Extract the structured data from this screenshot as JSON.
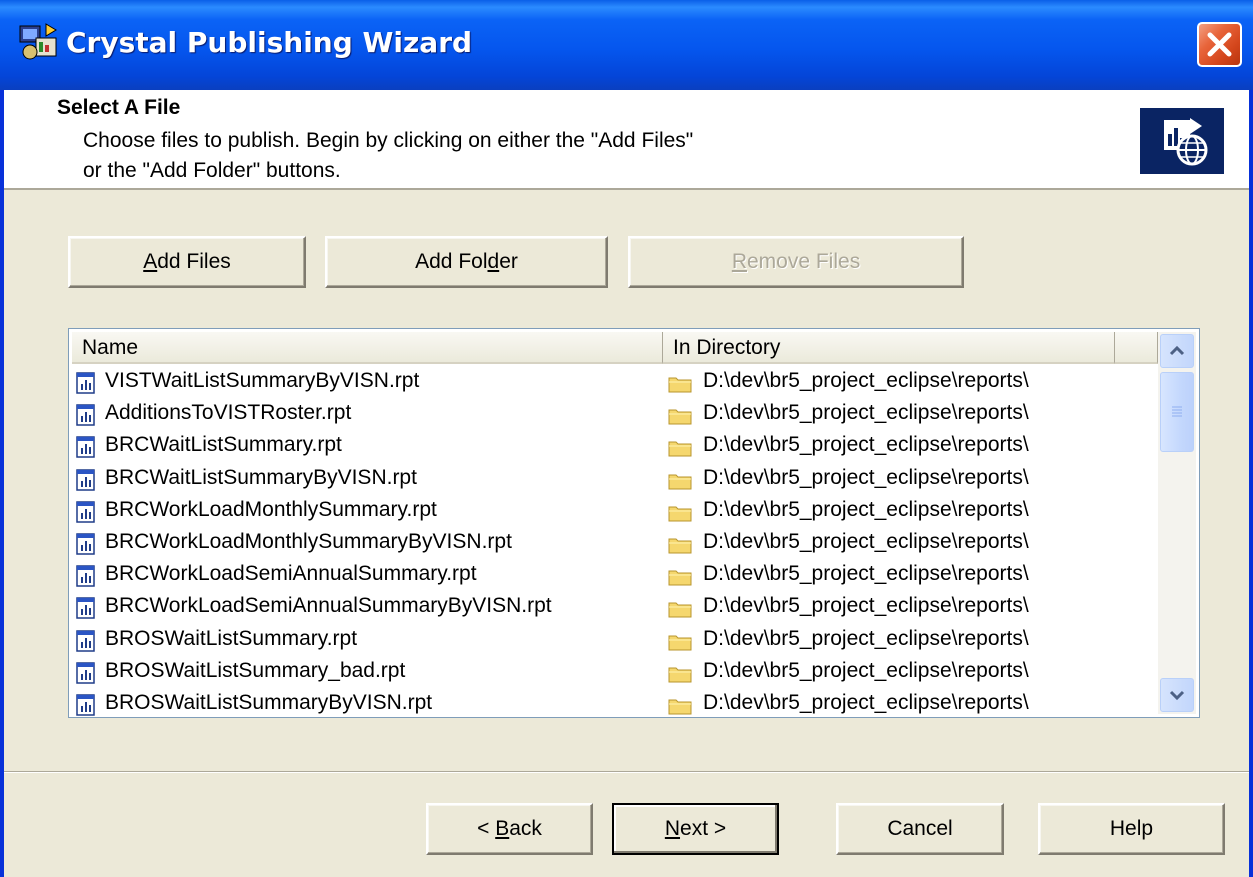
{
  "window": {
    "title": "Crystal Publishing Wizard"
  },
  "header": {
    "step_title": "Select A File",
    "description_line1": "Choose files to publish.  Begin by clicking on either the \"Add Files\"",
    "description_line2": "or the \"Add Folder\" buttons."
  },
  "toolbar": {
    "add_files": {
      "pre": "",
      "key": "A",
      "post": "dd Files"
    },
    "add_folder": {
      "pre": "Add Fol",
      "key": "d",
      "post": "er"
    },
    "remove_files": {
      "pre": "",
      "key": "R",
      "post": "emove Files",
      "disabled": true
    }
  },
  "list": {
    "columns": [
      "Name",
      "In Directory"
    ],
    "rows": [
      {
        "name": "VISTWaitListSummaryByVISN.rpt",
        "dir": "D:\\dev\\br5_project_eclipse\\reports\\"
      },
      {
        "name": "AdditionsToVISTRoster.rpt",
        "dir": "D:\\dev\\br5_project_eclipse\\reports\\"
      },
      {
        "name": "BRCWaitListSummary.rpt",
        "dir": "D:\\dev\\br5_project_eclipse\\reports\\"
      },
      {
        "name": "BRCWaitListSummaryByVISN.rpt",
        "dir": "D:\\dev\\br5_project_eclipse\\reports\\"
      },
      {
        "name": "BRCWorkLoadMonthlySummary.rpt",
        "dir": "D:\\dev\\br5_project_eclipse\\reports\\"
      },
      {
        "name": "BRCWorkLoadMonthlySummaryByVISN.rpt",
        "dir": "D:\\dev\\br5_project_eclipse\\reports\\"
      },
      {
        "name": "BRCWorkLoadSemiAnnualSummary.rpt",
        "dir": "D:\\dev\\br5_project_eclipse\\reports\\"
      },
      {
        "name": "BRCWorkLoadSemiAnnualSummaryByVISN.rpt",
        "dir": "D:\\dev\\br5_project_eclipse\\reports\\"
      },
      {
        "name": "BROSWaitListSummary.rpt",
        "dir": "D:\\dev\\br5_project_eclipse\\reports\\"
      },
      {
        "name": "BROSWaitListSummary_bad.rpt",
        "dir": "D:\\dev\\br5_project_eclipse\\reports\\"
      },
      {
        "name": "BROSWaitListSummaryByVISN.rpt",
        "dir": "D:\\dev\\br5_project_eclipse\\reports\\"
      }
    ],
    "icons": {
      "file": "report-file-icon",
      "folder": "folder-icon"
    }
  },
  "footer": {
    "back": {
      "pre": "< ",
      "key": "B",
      "post": "ack"
    },
    "next": {
      "pre": "",
      "key": "N",
      "post": "ext >"
    },
    "cancel": "Cancel",
    "help": "Help"
  },
  "colors": {
    "titlebar": "#0554e8",
    "dialog_bg": "#ece9d8",
    "badge_bg": "#0a2463",
    "close_button": "#d4461c",
    "disabled_text": "#aca899"
  }
}
